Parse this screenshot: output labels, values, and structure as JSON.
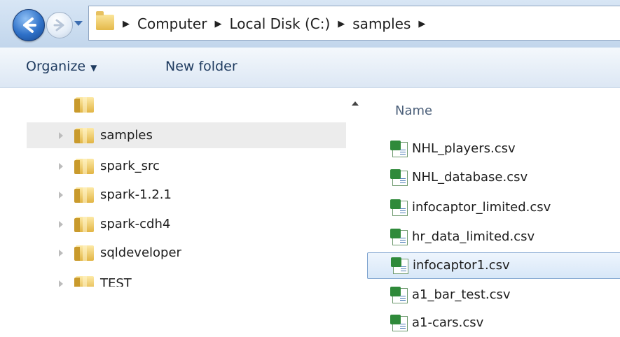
{
  "address_bar": {
    "crumbs": [
      "Computer",
      "Local Disk (C:)",
      "samples"
    ],
    "separator": "▶"
  },
  "toolbar": {
    "organize_label": "Organize",
    "dropdown_glyph": "▼",
    "new_folder_label": "New folder"
  },
  "nav_pane": {
    "items": [
      {
        "label": "samples",
        "selected": true
      },
      {
        "label": "spark_src",
        "selected": false
      },
      {
        "label": "spark-1.2.1",
        "selected": false
      },
      {
        "label": "spark-cdh4",
        "selected": false
      },
      {
        "label": "sqldeveloper",
        "selected": false
      },
      {
        "label": "TEST",
        "selected": false
      }
    ]
  },
  "file_list": {
    "column_name": "Name",
    "files": [
      {
        "name": "NHL_players.csv",
        "selected": false
      },
      {
        "name": "NHL_database.csv",
        "selected": false
      },
      {
        "name": "infocaptor_limited.csv",
        "selected": false
      },
      {
        "name": "hr_data_limited.csv",
        "selected": false
      },
      {
        "name": "infocaptor1.csv",
        "selected": true
      },
      {
        "name": "a1_bar_test.csv",
        "selected": false
      },
      {
        "name": "a1-cars.csv",
        "selected": false
      }
    ]
  },
  "icons": {
    "back": "back-arrow-icon",
    "forward": "forward-arrow-icon",
    "folder": "folder-icon",
    "file": "csv-file-icon"
  },
  "colors": {
    "selection_fill": "#d7e7f8",
    "selection_border": "#7da2ce",
    "nav_selected": "#ececec",
    "toolbar_text": "#1e3a5f"
  }
}
